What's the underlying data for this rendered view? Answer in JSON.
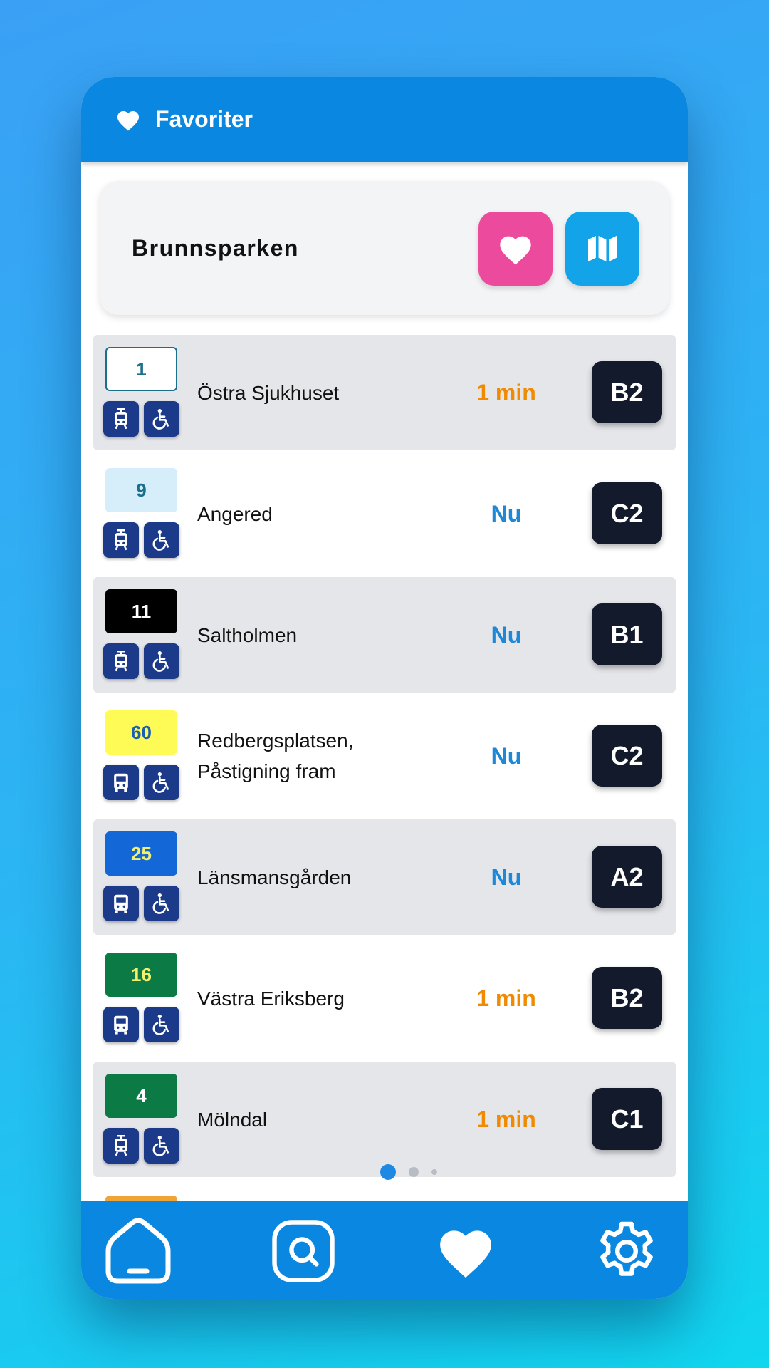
{
  "header": {
    "title": "Favoriter",
    "icon": "heart-icon"
  },
  "stop": {
    "name": "Brunnsparken",
    "fav_icon": "heart-icon",
    "map_icon": "map-icon"
  },
  "colors": {
    "primary": "#0a87e0",
    "fav_button": "#ec4a9c",
    "map_button": "#12a3e8",
    "time_now": "#1e88d6",
    "time_min": "#f08a00",
    "platform_bg": "#131a2c",
    "icon_bg": "#1c3a8a"
  },
  "departures": [
    {
      "line": "1",
      "badge_bg": "#ffffff",
      "badge_fg": "#1a6f8a",
      "badge_border": "#1a6f8a",
      "vehicle": "tram-icon",
      "destination": "Östra Sjukhuset",
      "time": "1 min",
      "time_kind": "min",
      "platform": "B2"
    },
    {
      "line": "9",
      "badge_bg": "#d6eefa",
      "badge_fg": "#1a6f8a",
      "badge_border": "",
      "vehicle": "tram-icon",
      "destination": "Angered",
      "time": "Nu",
      "time_kind": "now",
      "platform": "C2"
    },
    {
      "line": "11",
      "badge_bg": "#000000",
      "badge_fg": "#ffffff",
      "badge_border": "",
      "vehicle": "tram-icon",
      "destination": "Saltholmen",
      "time": "Nu",
      "time_kind": "now",
      "platform": "B1"
    },
    {
      "line": "60",
      "badge_bg": "#fffb56",
      "badge_fg": "#1a5fb4",
      "badge_border": "",
      "vehicle": "bus-icon",
      "destination": "Redbergsplatsen, Påstigning fram",
      "time": "Nu",
      "time_kind": "now",
      "platform": "C2"
    },
    {
      "line": "25",
      "badge_bg": "#1467d6",
      "badge_fg": "#f5f06a",
      "badge_border": "",
      "vehicle": "bus-icon",
      "destination": "Länsmansgården",
      "time": "Nu",
      "time_kind": "now",
      "platform": "A2"
    },
    {
      "line": "16",
      "badge_bg": "#0c7a45",
      "badge_fg": "#f5f06a",
      "badge_border": "",
      "vehicle": "bus-icon",
      "destination": "Västra Eriksberg",
      "time": "1 min",
      "time_kind": "min",
      "platform": "B2"
    },
    {
      "line": "4",
      "badge_bg": "#0c7a45",
      "badge_fg": "#ffffff",
      "badge_border": "",
      "vehicle": "tram-icon",
      "destination": "Mölndal",
      "time": "1 min",
      "time_kind": "min",
      "platform": "C1"
    }
  ],
  "pager": {
    "pages": 3,
    "active": 0
  },
  "nav": [
    {
      "name": "home",
      "icon": "home-icon"
    },
    {
      "name": "search",
      "icon": "search-icon"
    },
    {
      "name": "favorites",
      "icon": "heart-icon"
    },
    {
      "name": "settings",
      "icon": "gear-icon"
    }
  ]
}
